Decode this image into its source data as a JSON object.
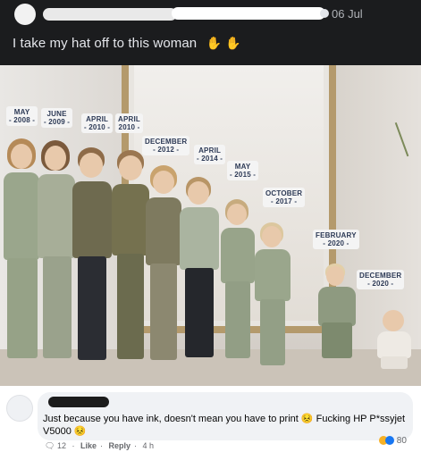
{
  "post": {
    "time": "06 Jul",
    "text": "I take my hat off to this woman",
    "emoji_icon": "woman-gesture-emoji"
  },
  "photo": {
    "labels": [
      {
        "month": "MAY",
        "year": "- 2008 -"
      },
      {
        "month": "JUNE",
        "year": "- 2009 -"
      },
      {
        "month": "APRIL",
        "year": "- 2010 -"
      },
      {
        "month": "APRIL",
        "year": "2010 -"
      },
      {
        "month": "DECEMBER",
        "year": "- 2012 -"
      },
      {
        "month": "APRIL",
        "year": "- 2014 -"
      },
      {
        "month": "MAY",
        "year": "- 2015 -"
      },
      {
        "month": "OCTOBER",
        "year": "- 2017 -"
      },
      {
        "month": "FEBRUARY",
        "year": "- 2020 -"
      },
      {
        "month": "DECEMBER",
        "year": "- 2020 -"
      }
    ],
    "colors": {
      "outfit_sage": "#9aa68c",
      "outfit_olive": "#6b6b4e",
      "outfit_dark": "#2b2d33",
      "label_text": "#2d3a56"
    }
  },
  "comment": {
    "text_part1": "Just because you have ink, doesn't mean you have to print ",
    "text_part2": " Fucking HP P*ssyjet V5000 ",
    "emoji_1": "😣",
    "emoji_2": "😣",
    "likes": "12",
    "like_label": "Like",
    "reply_label": "Reply",
    "time": "4 h",
    "reaction_count": "80"
  }
}
